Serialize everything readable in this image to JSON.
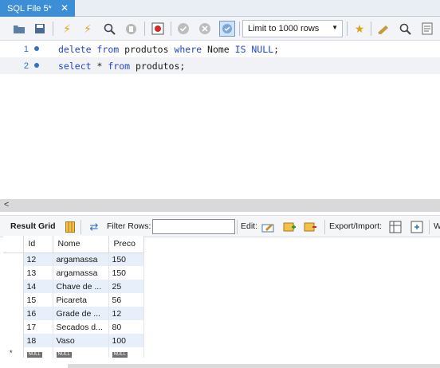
{
  "tab": {
    "title": "SQL File 5*",
    "close": "✕"
  },
  "toolbar": {
    "limit_label": "Limit to 1000 rows"
  },
  "editor": {
    "lines": [
      {
        "num": "1"
      },
      {
        "num": "2"
      }
    ],
    "line1": {
      "k1": "delete",
      "k2": "from",
      "t1": "produtos",
      "k3": "where",
      "t2": "Nome",
      "k4": "IS NULL",
      "t3": ";"
    },
    "line2": {
      "k1": "select",
      "t1": "*",
      "k2": "from",
      "t2": "produtos;"
    }
  },
  "result_toolbar": {
    "result_grid": "Result Grid",
    "filter_rows": "Filter Rows:",
    "edit": "Edit:",
    "export_import": "Export/Import:",
    "trailing": "W"
  },
  "grid": {
    "columns": [
      "Id",
      "Nome",
      "Preco"
    ],
    "rows": [
      [
        "12",
        "argamassa",
        "150"
      ],
      [
        "13",
        "argamassa",
        "150"
      ],
      [
        "14",
        "Chave de ...",
        "25"
      ],
      [
        "15",
        "Picareta",
        "56"
      ],
      [
        "16",
        "Grade de ...",
        "12"
      ],
      [
        "17",
        "Secados d...",
        "80"
      ],
      [
        "18",
        "Vaso",
        "100"
      ]
    ],
    "null_label": "NULL",
    "new_row_marker": "*"
  },
  "colors": {
    "tab_active": "#3c8fd6",
    "keyword": "#2445c8",
    "row_alt": "#e6effa"
  }
}
